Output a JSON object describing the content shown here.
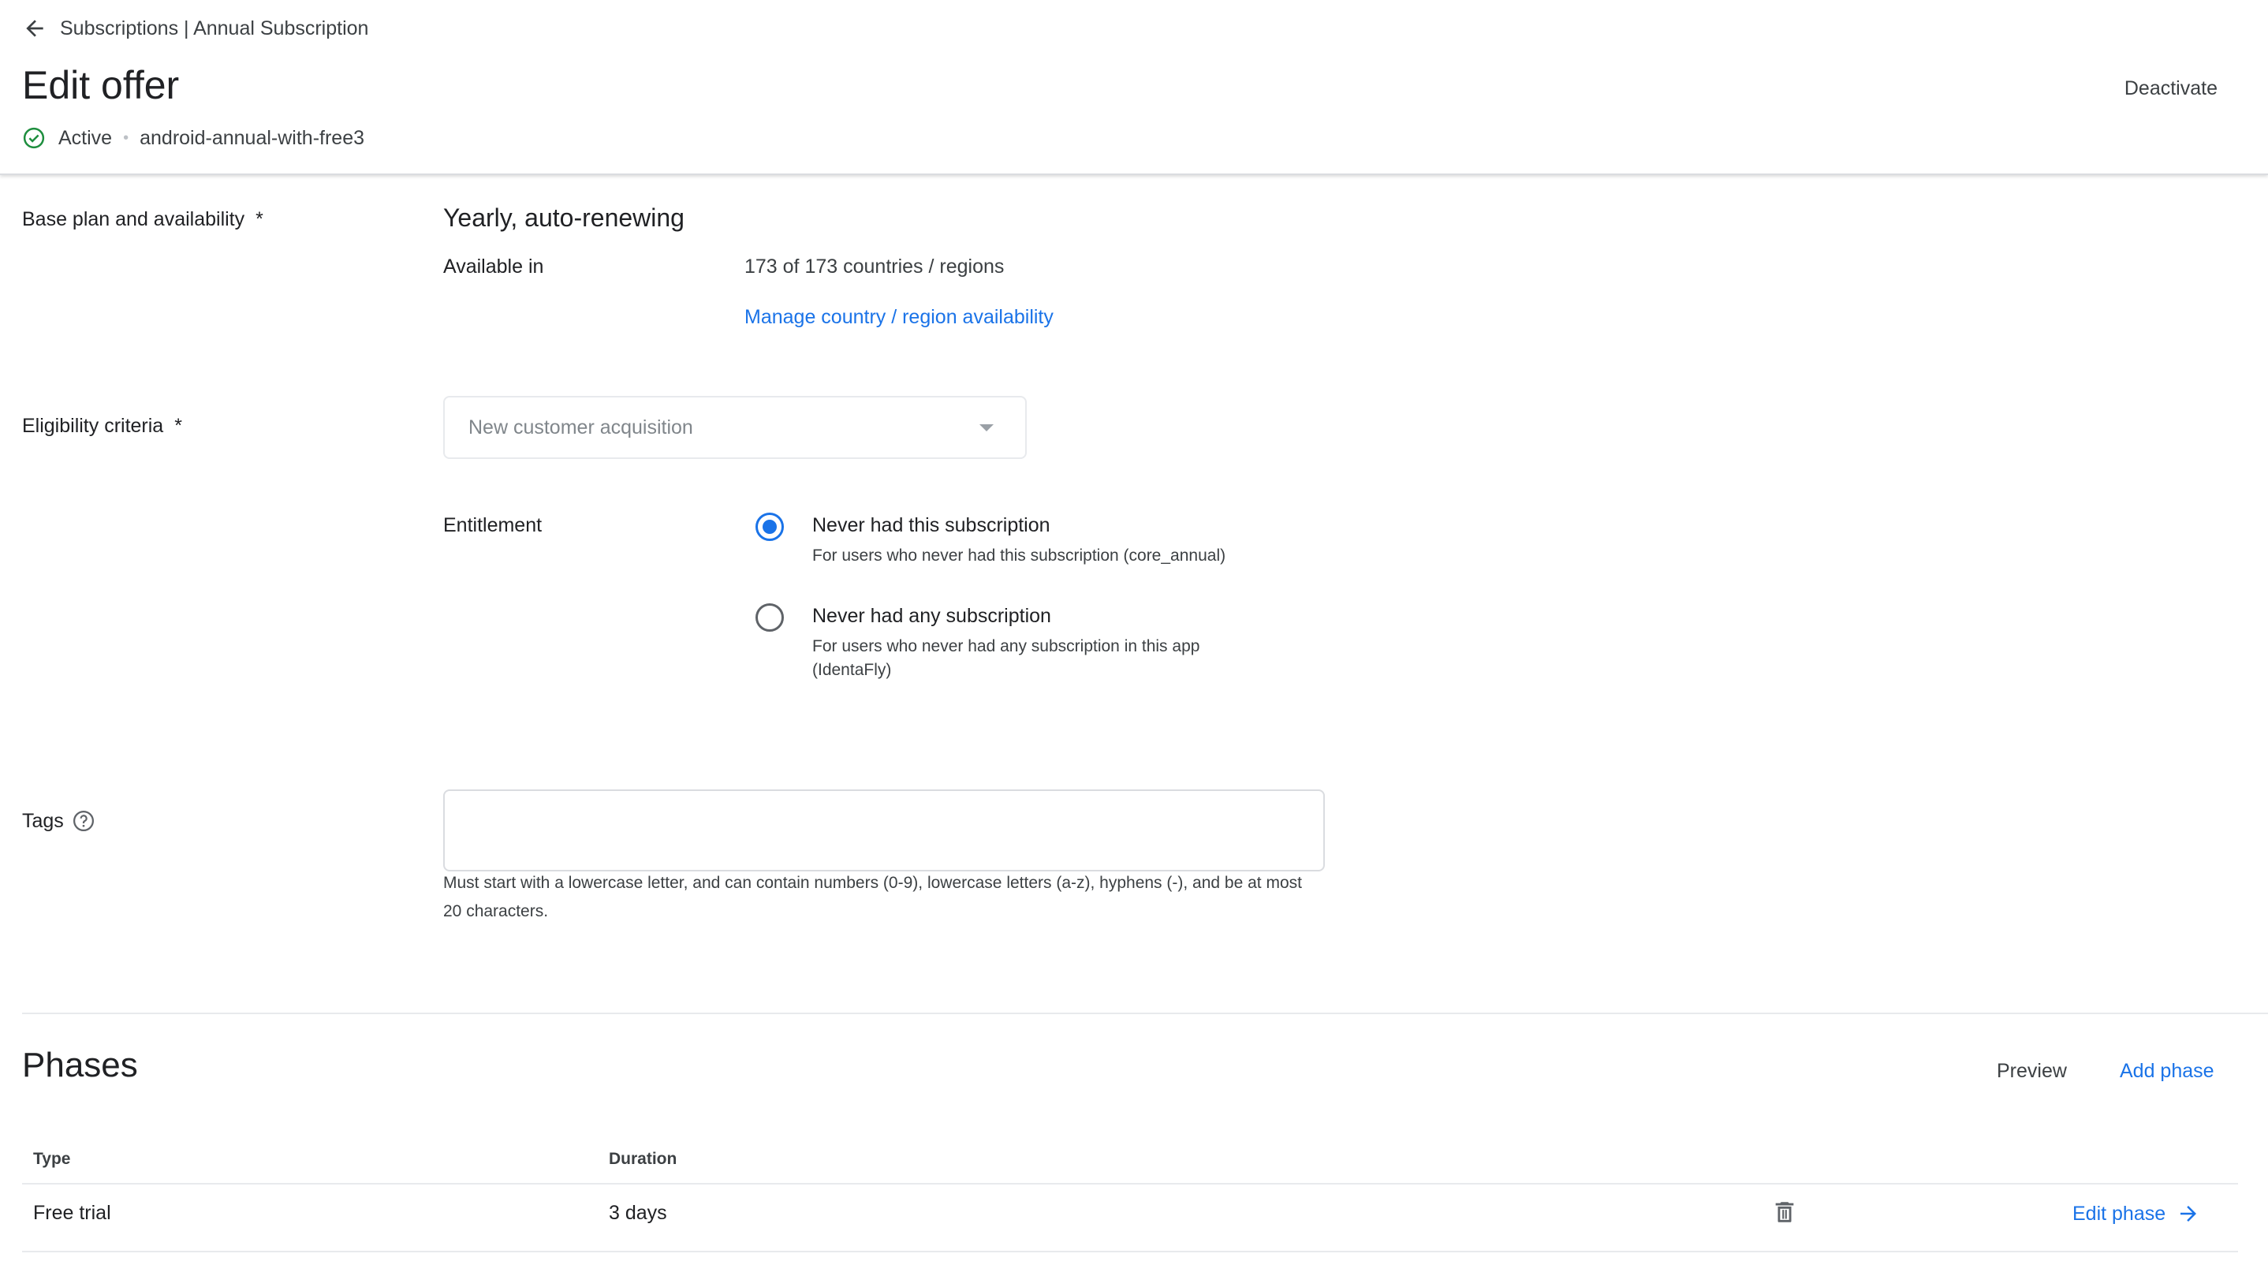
{
  "header": {
    "breadcrumb": "Subscriptions | Annual Subscription",
    "title": "Edit offer",
    "status": "Active",
    "offer_id": "android-annual-with-free3",
    "deactivate_label": "Deactivate"
  },
  "base_plan": {
    "label": "Base plan and availability",
    "required_mark": "*",
    "plan_name": "Yearly, auto-renewing",
    "available_label": "Available in",
    "available_value": "173 of 173 countries / regions",
    "manage_link": "Manage country / region availability"
  },
  "eligibility": {
    "label": "Eligibility criteria",
    "required_mark": "*",
    "selected": "New customer acquisition",
    "entitlement_label": "Entitlement",
    "options": [
      {
        "title": "Never had this subscription",
        "description": "For users who never had this subscription (core_annual)",
        "checked": true
      },
      {
        "title": "Never had any subscription",
        "description": "For users who never had any subscription in this app (IdentaFly)",
        "checked": false
      }
    ]
  },
  "tags": {
    "label": "Tags",
    "value": "",
    "hint": "Must start with a lowercase letter, and can contain numbers (0-9), lowercase letters (a-z), hyphens (-), and be at most 20 characters."
  },
  "phases": {
    "title": "Phases",
    "preview_label": "Preview",
    "add_phase_label": "Add phase",
    "columns": [
      "Type",
      "Duration"
    ],
    "rows": [
      {
        "type": "Free trial",
        "duration": "3 days",
        "edit_label": "Edit phase"
      }
    ]
  },
  "colors": {
    "accent": "#1a73e8",
    "active_status": "#1e8e3e"
  },
  "icons": [
    "arrow-left-icon",
    "check-circle-icon",
    "help-circle-icon",
    "dropdown-caret-icon",
    "trash-icon",
    "arrow-right-icon"
  ]
}
